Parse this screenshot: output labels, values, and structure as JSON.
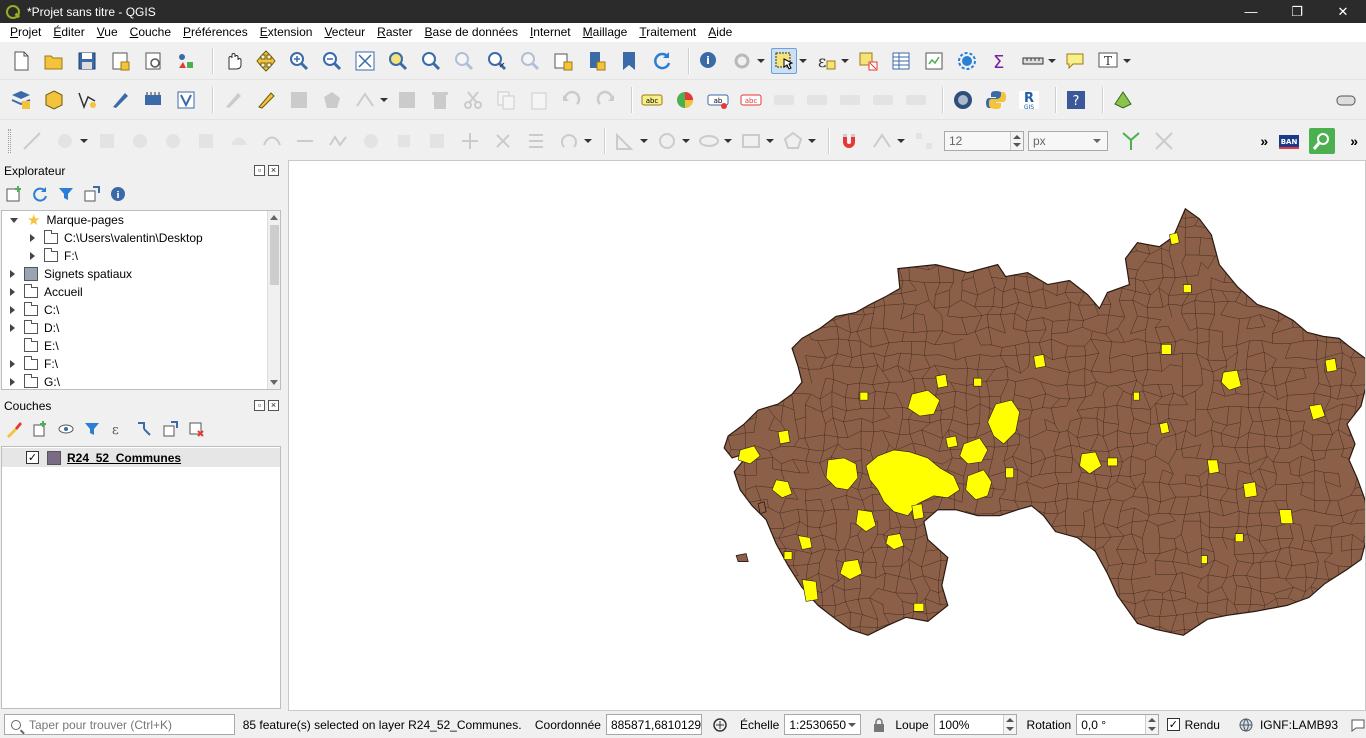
{
  "window": {
    "title": "*Projet sans titre - QGIS",
    "minimize": "—",
    "maximize": "❐",
    "close": "✕"
  },
  "menu": [
    "Projet",
    "Éditer",
    "Vue",
    "Couche",
    "Préférences",
    "Extension",
    "Vecteur",
    "Raster",
    "Base de données",
    "Internet",
    "Maillage",
    "Traitement",
    "Aide"
  ],
  "toolbar3": {
    "snap_tolerance": "12",
    "snap_unit": "px",
    "ban_label": "BAN"
  },
  "browser": {
    "title": "Explorateur",
    "items": [
      {
        "label": "Marque-pages",
        "level": 0,
        "expanded": true,
        "icon": "star-icon"
      },
      {
        "label": "C:\\Users\\valentin\\Desktop",
        "level": 1,
        "expanded": false,
        "icon": "folder-icon"
      },
      {
        "label": "F:\\",
        "level": 1,
        "expanded": false,
        "icon": "folder-icon"
      },
      {
        "label": "Signets spatiaux",
        "level": 0,
        "expanded": false,
        "icon": "bookmark-icon"
      },
      {
        "label": "Accueil",
        "level": 0,
        "expanded": false,
        "icon": "home-folder-icon"
      },
      {
        "label": "C:\\",
        "level": 0,
        "expanded": false,
        "icon": "folder-icon"
      },
      {
        "label": "D:\\",
        "level": 0,
        "expanded": false,
        "icon": "folder-icon"
      },
      {
        "label": "E:\\",
        "level": 0,
        "expanded": false,
        "icon": "folder-icon"
      },
      {
        "label": "F:\\",
        "level": 0,
        "expanded": false,
        "icon": "folder-icon"
      },
      {
        "label": "G:\\",
        "level": 0,
        "expanded": false,
        "icon": "folder-icon"
      }
    ]
  },
  "layers": {
    "title": "Couches",
    "items": [
      {
        "name": "R24_52_Communes",
        "checked": true,
        "color": "#7a6b84"
      }
    ]
  },
  "map": {
    "fill_color": "#8c6048",
    "selected_color": "#ffff00",
    "outline_color": "#2a1a12"
  },
  "status": {
    "search_placeholder": "Taper pour trouver (Ctrl+K)",
    "message": "85 feature(s) selected on layer R24_52_Communes.",
    "coord_label": "Coordonnée",
    "coord_value": "885871,6810129",
    "scale_label": "Échelle",
    "scale_value": "1:2530650",
    "magnifier_label": "Loupe",
    "magnifier_value": "100%",
    "rotation_label": "Rotation",
    "rotation_value": "0,0 °",
    "render_label": "Rendu",
    "crs_label": "IGNF:LAMB93"
  }
}
